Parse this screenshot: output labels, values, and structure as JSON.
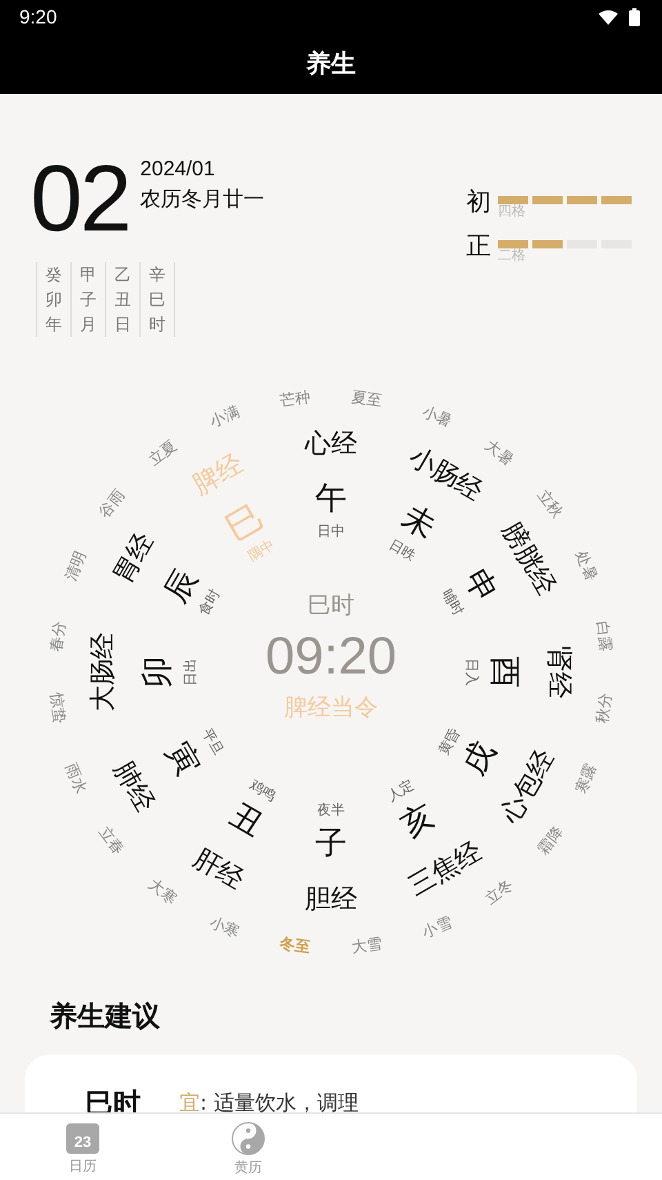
{
  "status_bar": {
    "time": "9:20"
  },
  "title": "养生",
  "date": {
    "day": "02",
    "month": "2024/01",
    "lunar": "农历冬月廿一"
  },
  "pillars": [
    "癸卯年",
    "甲子月",
    "乙丑日",
    "辛巳时"
  ],
  "ranks": [
    {
      "char": "初",
      "level": 1,
      "caption": "四格"
    },
    {
      "char": "正",
      "level": 0.5,
      "caption": "二格"
    }
  ],
  "wheel": {
    "current_hour": "巳时",
    "clock": "09:20",
    "current_meridian": "脾经当令",
    "hours": [
      {
        "branch": "午",
        "meridian": "心经",
        "time_name": "日中",
        "selected": false
      },
      {
        "branch": "未",
        "meridian": "小肠经",
        "time_name": "日昳",
        "selected": false
      },
      {
        "branch": "申",
        "meridian": "膀胱经",
        "time_name": "晡时",
        "selected": false
      },
      {
        "branch": "酉",
        "meridian": "肾经",
        "time_name": "日入",
        "selected": false
      },
      {
        "branch": "戌",
        "meridian": "心包经",
        "time_name": "黄昏",
        "selected": false
      },
      {
        "branch": "亥",
        "meridian": "三焦经",
        "time_name": "人定",
        "selected": false
      },
      {
        "branch": "子",
        "meridian": "胆经",
        "time_name": "夜半",
        "selected": false
      },
      {
        "branch": "丑",
        "meridian": "肝经",
        "time_name": "鸡鸣",
        "selected": false
      },
      {
        "branch": "寅",
        "meridian": "肺经",
        "time_name": "平旦",
        "selected": false
      },
      {
        "branch": "卯",
        "meridian": "大肠经",
        "time_name": "日出",
        "selected": false
      },
      {
        "branch": "辰",
        "meridian": "胃经",
        "time_name": "食时",
        "selected": false
      },
      {
        "branch": "巳",
        "meridian": "脾经",
        "time_name": "隅中",
        "selected": true
      }
    ],
    "solar_terms": [
      {
        "name": "芒种",
        "selected": false
      },
      {
        "name": "夏至",
        "selected": false
      },
      {
        "name": "小暑",
        "selected": false
      },
      {
        "name": "大暑",
        "selected": false
      },
      {
        "name": "立秋",
        "selected": false
      },
      {
        "name": "处暑",
        "selected": false
      },
      {
        "name": "白露",
        "selected": false
      },
      {
        "name": "秋分",
        "selected": false
      },
      {
        "name": "寒露",
        "selected": false
      },
      {
        "name": "霜降",
        "selected": false
      },
      {
        "name": "立冬",
        "selected": false
      },
      {
        "name": "小雪",
        "selected": false
      },
      {
        "name": "大雪",
        "selected": false
      },
      {
        "name": "冬至",
        "selected": true
      },
      {
        "name": "小寒",
        "selected": false
      },
      {
        "name": "大寒",
        "selected": false
      },
      {
        "name": "立春",
        "selected": false
      },
      {
        "name": "雨水",
        "selected": false
      },
      {
        "name": "惊蛰",
        "selected": false
      },
      {
        "name": "春分",
        "selected": false
      },
      {
        "name": "清明",
        "selected": false
      },
      {
        "name": "谷雨",
        "selected": false
      },
      {
        "name": "立夏",
        "selected": false
      },
      {
        "name": "小满",
        "selected": false
      }
    ]
  },
  "advice": {
    "heading": "养生建议",
    "hour": "巳时",
    "label": "宜",
    "text": ": 适量饮水，调理"
  },
  "tabs": [
    {
      "label": "日历",
      "kind": "calendar",
      "icon_text": "23",
      "selected": false
    },
    {
      "label": "黄历",
      "kind": "yinyang",
      "selected": false
    }
  ]
}
